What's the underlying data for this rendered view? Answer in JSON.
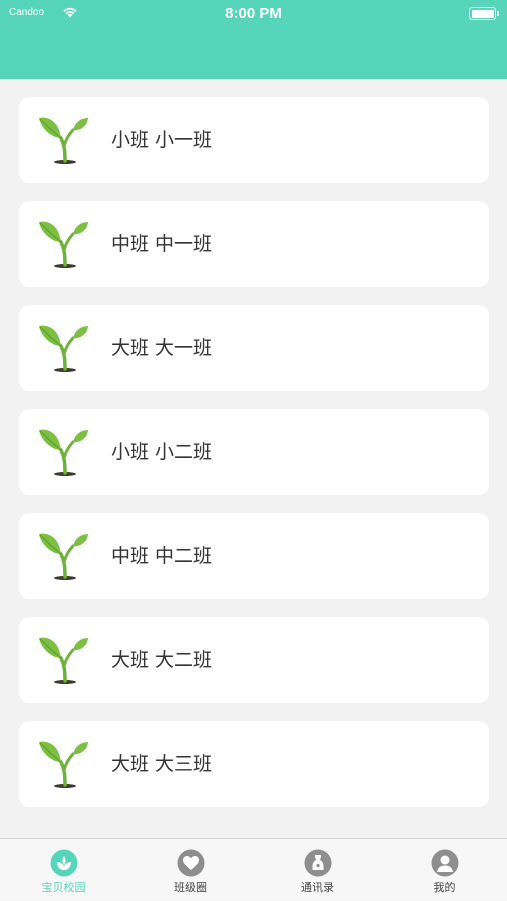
{
  "status_bar": {
    "carrier": "Candoo",
    "time": "8:00 PM"
  },
  "colors": {
    "accent": "#56d5bb",
    "background": "#f2f2f2",
    "card": "#ffffff",
    "sprout_green": "#7cc043",
    "tab_icon_gray": "#8e8e8e"
  },
  "classes": [
    {
      "label": "小班 小一班",
      "icon": "sprout-icon"
    },
    {
      "label": "中班 中一班",
      "icon": "sprout-icon"
    },
    {
      "label": "大班 大一班",
      "icon": "sprout-icon"
    },
    {
      "label": "小班 小二班",
      "icon": "sprout-icon"
    },
    {
      "label": "中班 中二班",
      "icon": "sprout-icon"
    },
    {
      "label": "大班 大二班",
      "icon": "sprout-icon"
    },
    {
      "label": "大班 大三班",
      "icon": "sprout-icon"
    }
  ],
  "tabs": [
    {
      "label": "宝贝校园",
      "icon": "campus-icon",
      "active": true
    },
    {
      "label": "班级圈",
      "icon": "heart-icon",
      "active": false
    },
    {
      "label": "通讯录",
      "icon": "contacts-icon",
      "active": false
    },
    {
      "label": "我的",
      "icon": "profile-icon",
      "active": false
    }
  ]
}
